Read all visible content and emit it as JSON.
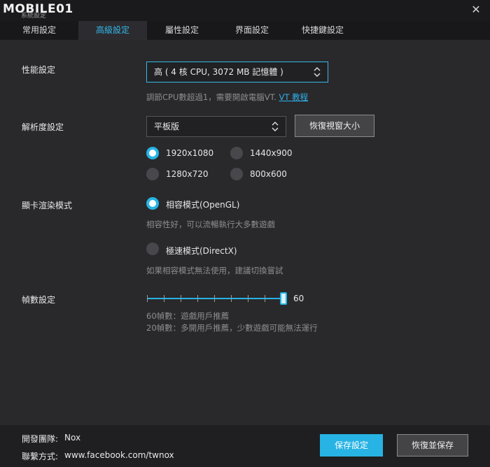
{
  "app": {
    "logo_text": "MOBILE01",
    "logo_sub": "系統設定",
    "close_glyph": "✕"
  },
  "tabs": [
    {
      "label": "常用設定",
      "active": false
    },
    {
      "label": "高級設定",
      "active": true
    },
    {
      "label": "屬性設定",
      "active": false
    },
    {
      "label": "界面設定",
      "active": false
    },
    {
      "label": "快捷鍵設定",
      "active": false
    }
  ],
  "performance": {
    "label": "性能設定",
    "selected": "高 ( 4 核 CPU, 3072 MB 記憶體 )",
    "hint_prefix": "調節CPU數超過1，需要開啟電腦VT.",
    "hint_link": "VT 教程"
  },
  "resolution": {
    "label": "解析度設定",
    "selected": "平板版",
    "restore_button": "恢復視窗大小",
    "options": [
      {
        "label": "1920x1080",
        "checked": true
      },
      {
        "label": "1440x900",
        "checked": false
      },
      {
        "label": "1280x720",
        "checked": false
      },
      {
        "label": "800x600",
        "checked": false
      }
    ]
  },
  "render": {
    "label": "顯卡渲染模式",
    "opengl_label": "相容模式(OpenGL)",
    "opengl_checked": true,
    "opengl_hint": "相容性好，可以流暢執行大多數遊戲",
    "directx_label": "極速模式(DirectX)",
    "directx_checked": false,
    "directx_hint": "如果相容模式無法使用，建議切換嘗試"
  },
  "fps": {
    "label": "幀數設定",
    "value": "60",
    "hint1": "60幀數：遊戲用戶推薦",
    "hint2": "20幀數：多開用戶推薦，少數遊戲可能無法運行"
  },
  "footer": {
    "dev_label": "開發團隊:",
    "dev_value": "Nox",
    "contact_label": "聯繫方式:",
    "contact_value": "www.facebook.com/twnox",
    "save_button": "保存設定",
    "restore_save_button": "恢復並保存"
  },
  "colors": {
    "accent": "#27b3e4",
    "background": "#29292c"
  }
}
